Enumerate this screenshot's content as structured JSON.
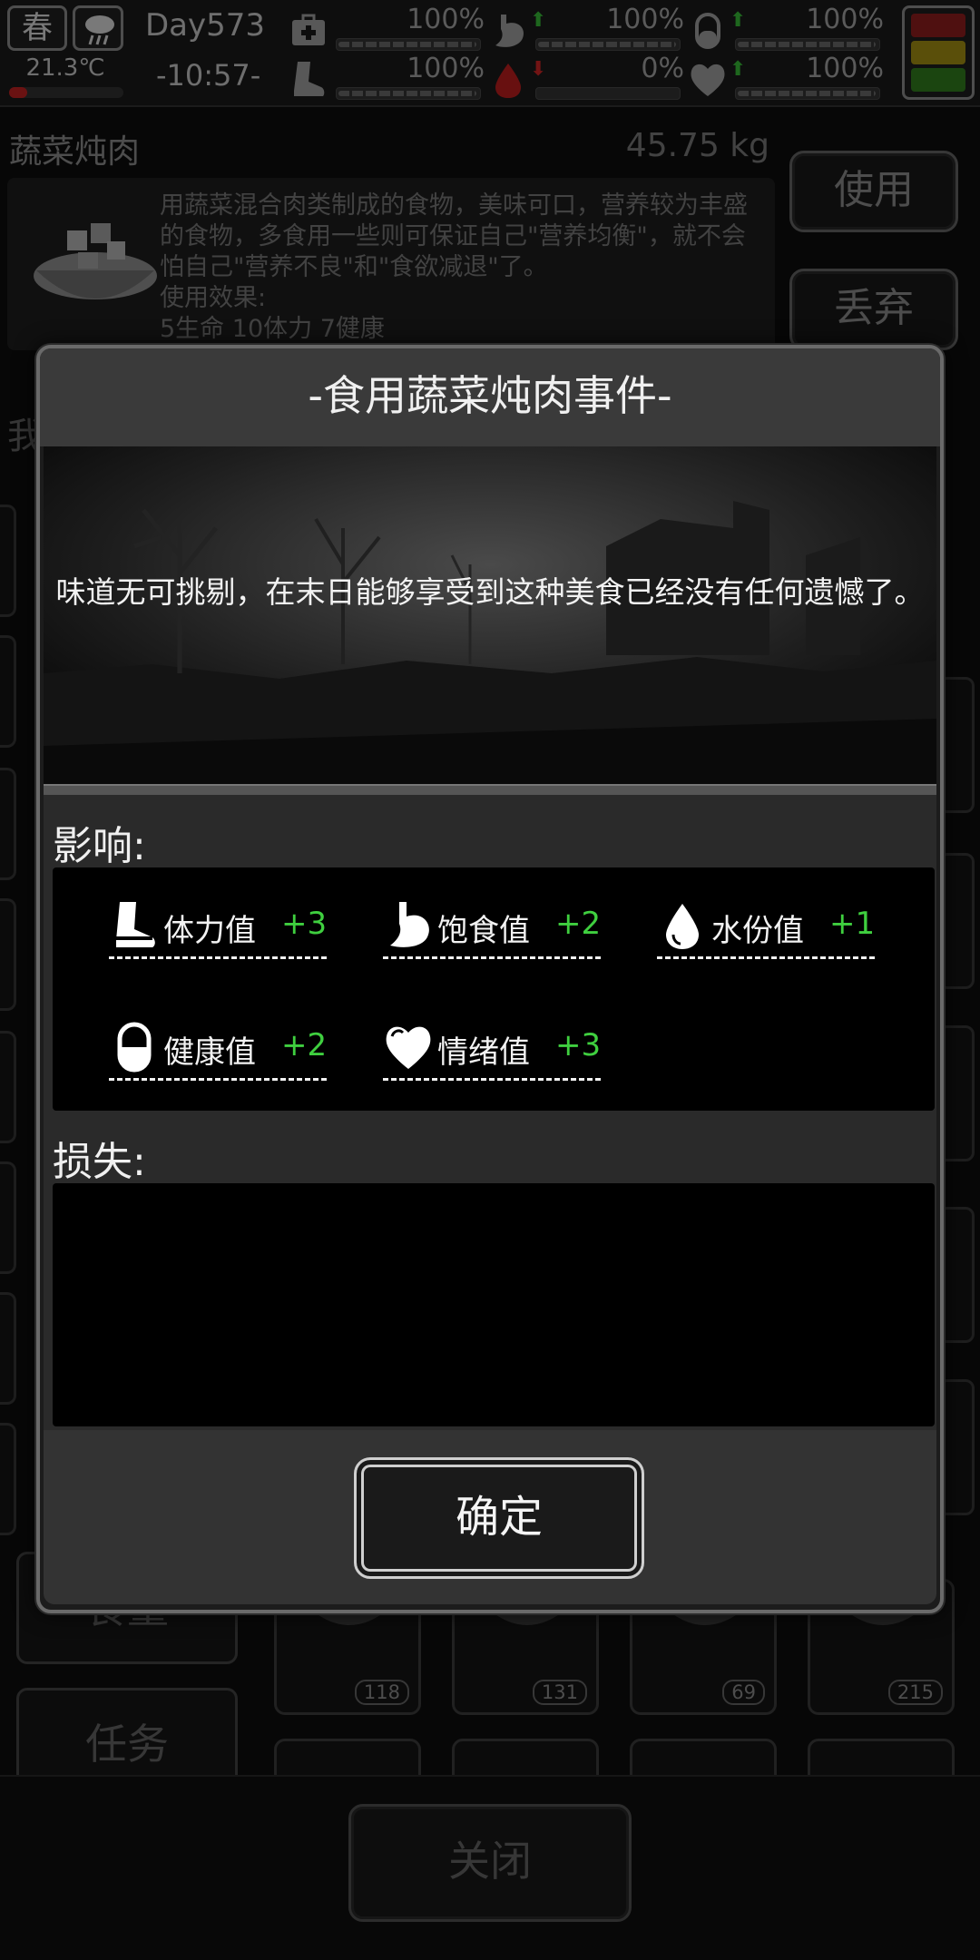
{
  "status": {
    "season": "春",
    "weather_icon": "cloud-rain-icon",
    "temperature": "21.3℃",
    "day": "Day573",
    "time": "-10:57-",
    "stats": [
      {
        "id": "health",
        "icon": "medkit-icon",
        "value": "100%",
        "level": 1.0
      },
      {
        "id": "satiety",
        "icon": "stomach-icon",
        "value": "100%",
        "level": 1.0,
        "trend": "up"
      },
      {
        "id": "sanity",
        "icon": "pill-icon",
        "value": "100%",
        "level": 1.0,
        "trend": "up"
      },
      {
        "id": "stamina",
        "icon": "boot-icon",
        "value": "100%",
        "level": 1.0
      },
      {
        "id": "water",
        "icon": "blood-drop-icon",
        "value": "0%",
        "level": 0.0,
        "trend": "down"
      },
      {
        "id": "mood",
        "icon": "heart-icon",
        "value": "100%",
        "level": 1.0,
        "trend": "up"
      }
    ],
    "alert_colors": [
      "#7a1a1a",
      "#8a7a10",
      "#2a6a1a"
    ]
  },
  "item": {
    "name": "蔬菜炖肉",
    "weight": "45.75 kg",
    "description": "用蔬菜混合肉类制成的食物，美味可口，营养较为丰盛的食物，多食用一些则可保证自己\"营养均衡\"，就不会怕自己\"营养不良\"和\"食欲减退\"了。",
    "effect_label": "使用效果:",
    "effect_value": "5生命 10体力 7健康",
    "use_label": "使用",
    "discard_label": "丢弃"
  },
  "background": {
    "partial_label": "我",
    "tabs": [
      "食量",
      "任务"
    ],
    "counts": [
      "118",
      "131",
      "69",
      "215"
    ],
    "close_label": "关闭"
  },
  "modal": {
    "title": "-食用蔬菜炖肉事件-",
    "event_text": "味道无可挑剔，在末日能够享受到这种美食已经没有任何遗憾了。",
    "effects_label": "影响:",
    "effects": [
      {
        "icon": "boot-icon",
        "name": "体力值",
        "value": "+3"
      },
      {
        "icon": "stomach-icon",
        "name": "饱食值",
        "value": "+2"
      },
      {
        "icon": "water-drop-icon",
        "name": "水份值",
        "value": "+1"
      },
      {
        "icon": "pill-icon",
        "name": "健康值",
        "value": "+2"
      },
      {
        "icon": "heart-icon",
        "name": "情绪值",
        "value": "+3"
      }
    ],
    "loss_label": "损失:",
    "losses": [],
    "confirm_label": "确定"
  }
}
